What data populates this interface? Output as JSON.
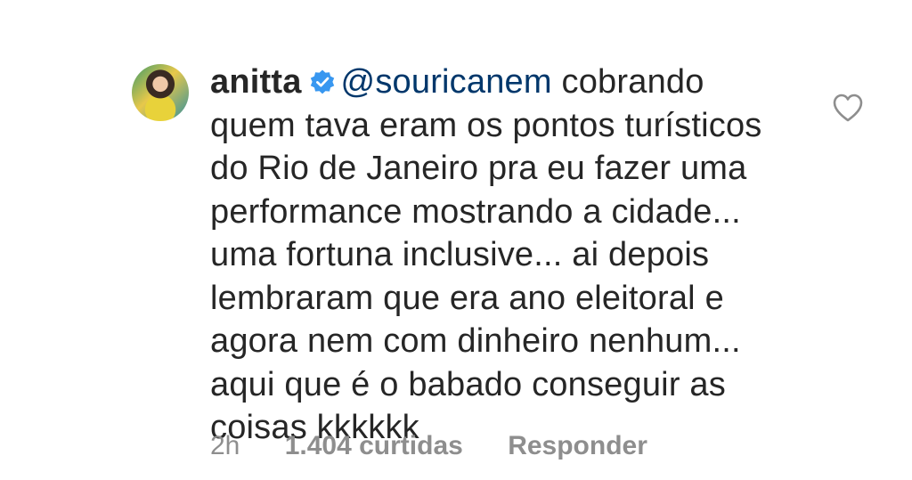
{
  "comment": {
    "username": "anitta",
    "mention": "@souricanem",
    "text": " cobrando quem tava eram os pontos turísticos do Rio de Janeiro pra eu fazer uma performance mostrando a cidade... uma fortuna inclusive... ai depois lembraram que era ano eleitoral e agora nem com dinheiro nenhum... aqui que é o babado conseguir as coisas kkkkkk",
    "time": "2h",
    "likes": "1.404 curtidas",
    "reply_label": "Responder"
  },
  "colors": {
    "text": "#262626",
    "mention": "#00376b",
    "secondary": "#8e8e8e",
    "verified": "#3897f0"
  },
  "icons": {
    "avatar": "avatar",
    "verified": "verified-badge-icon",
    "like": "heart-outline-icon"
  }
}
